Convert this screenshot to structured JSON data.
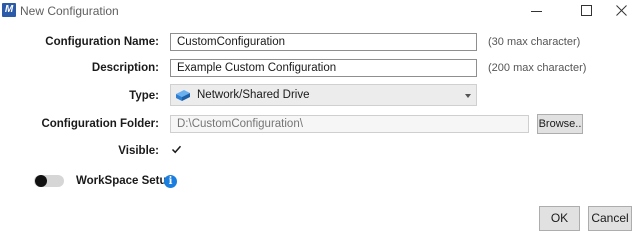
{
  "window": {
    "title": "New Configuration",
    "app_icon_glyph": "M"
  },
  "form": {
    "name": {
      "label": "Configuration Name:",
      "value": "CustomConfiguration",
      "hint": "(30 max character)"
    },
    "description": {
      "label": "Description:",
      "value": "Example Custom Configuration",
      "hint": "(200 max character)"
    },
    "type": {
      "label": "Type:",
      "selected": "Network/Shared Drive",
      "icon": "network-drive-icon"
    },
    "folder": {
      "label": "Configuration Folder:",
      "placeholder": "D:\\CustomConfiguration\\",
      "browse_label": "Browse.."
    },
    "visible": {
      "label": "Visible:",
      "checked": true
    }
  },
  "workspace": {
    "label": "WorkSpace Setup",
    "enabled": false,
    "info_glyph": "i"
  },
  "buttons": {
    "ok": "OK",
    "cancel": "Cancel"
  },
  "colors": {
    "accent": "#1a7ee0",
    "app_icon": "#2a5aa8"
  }
}
